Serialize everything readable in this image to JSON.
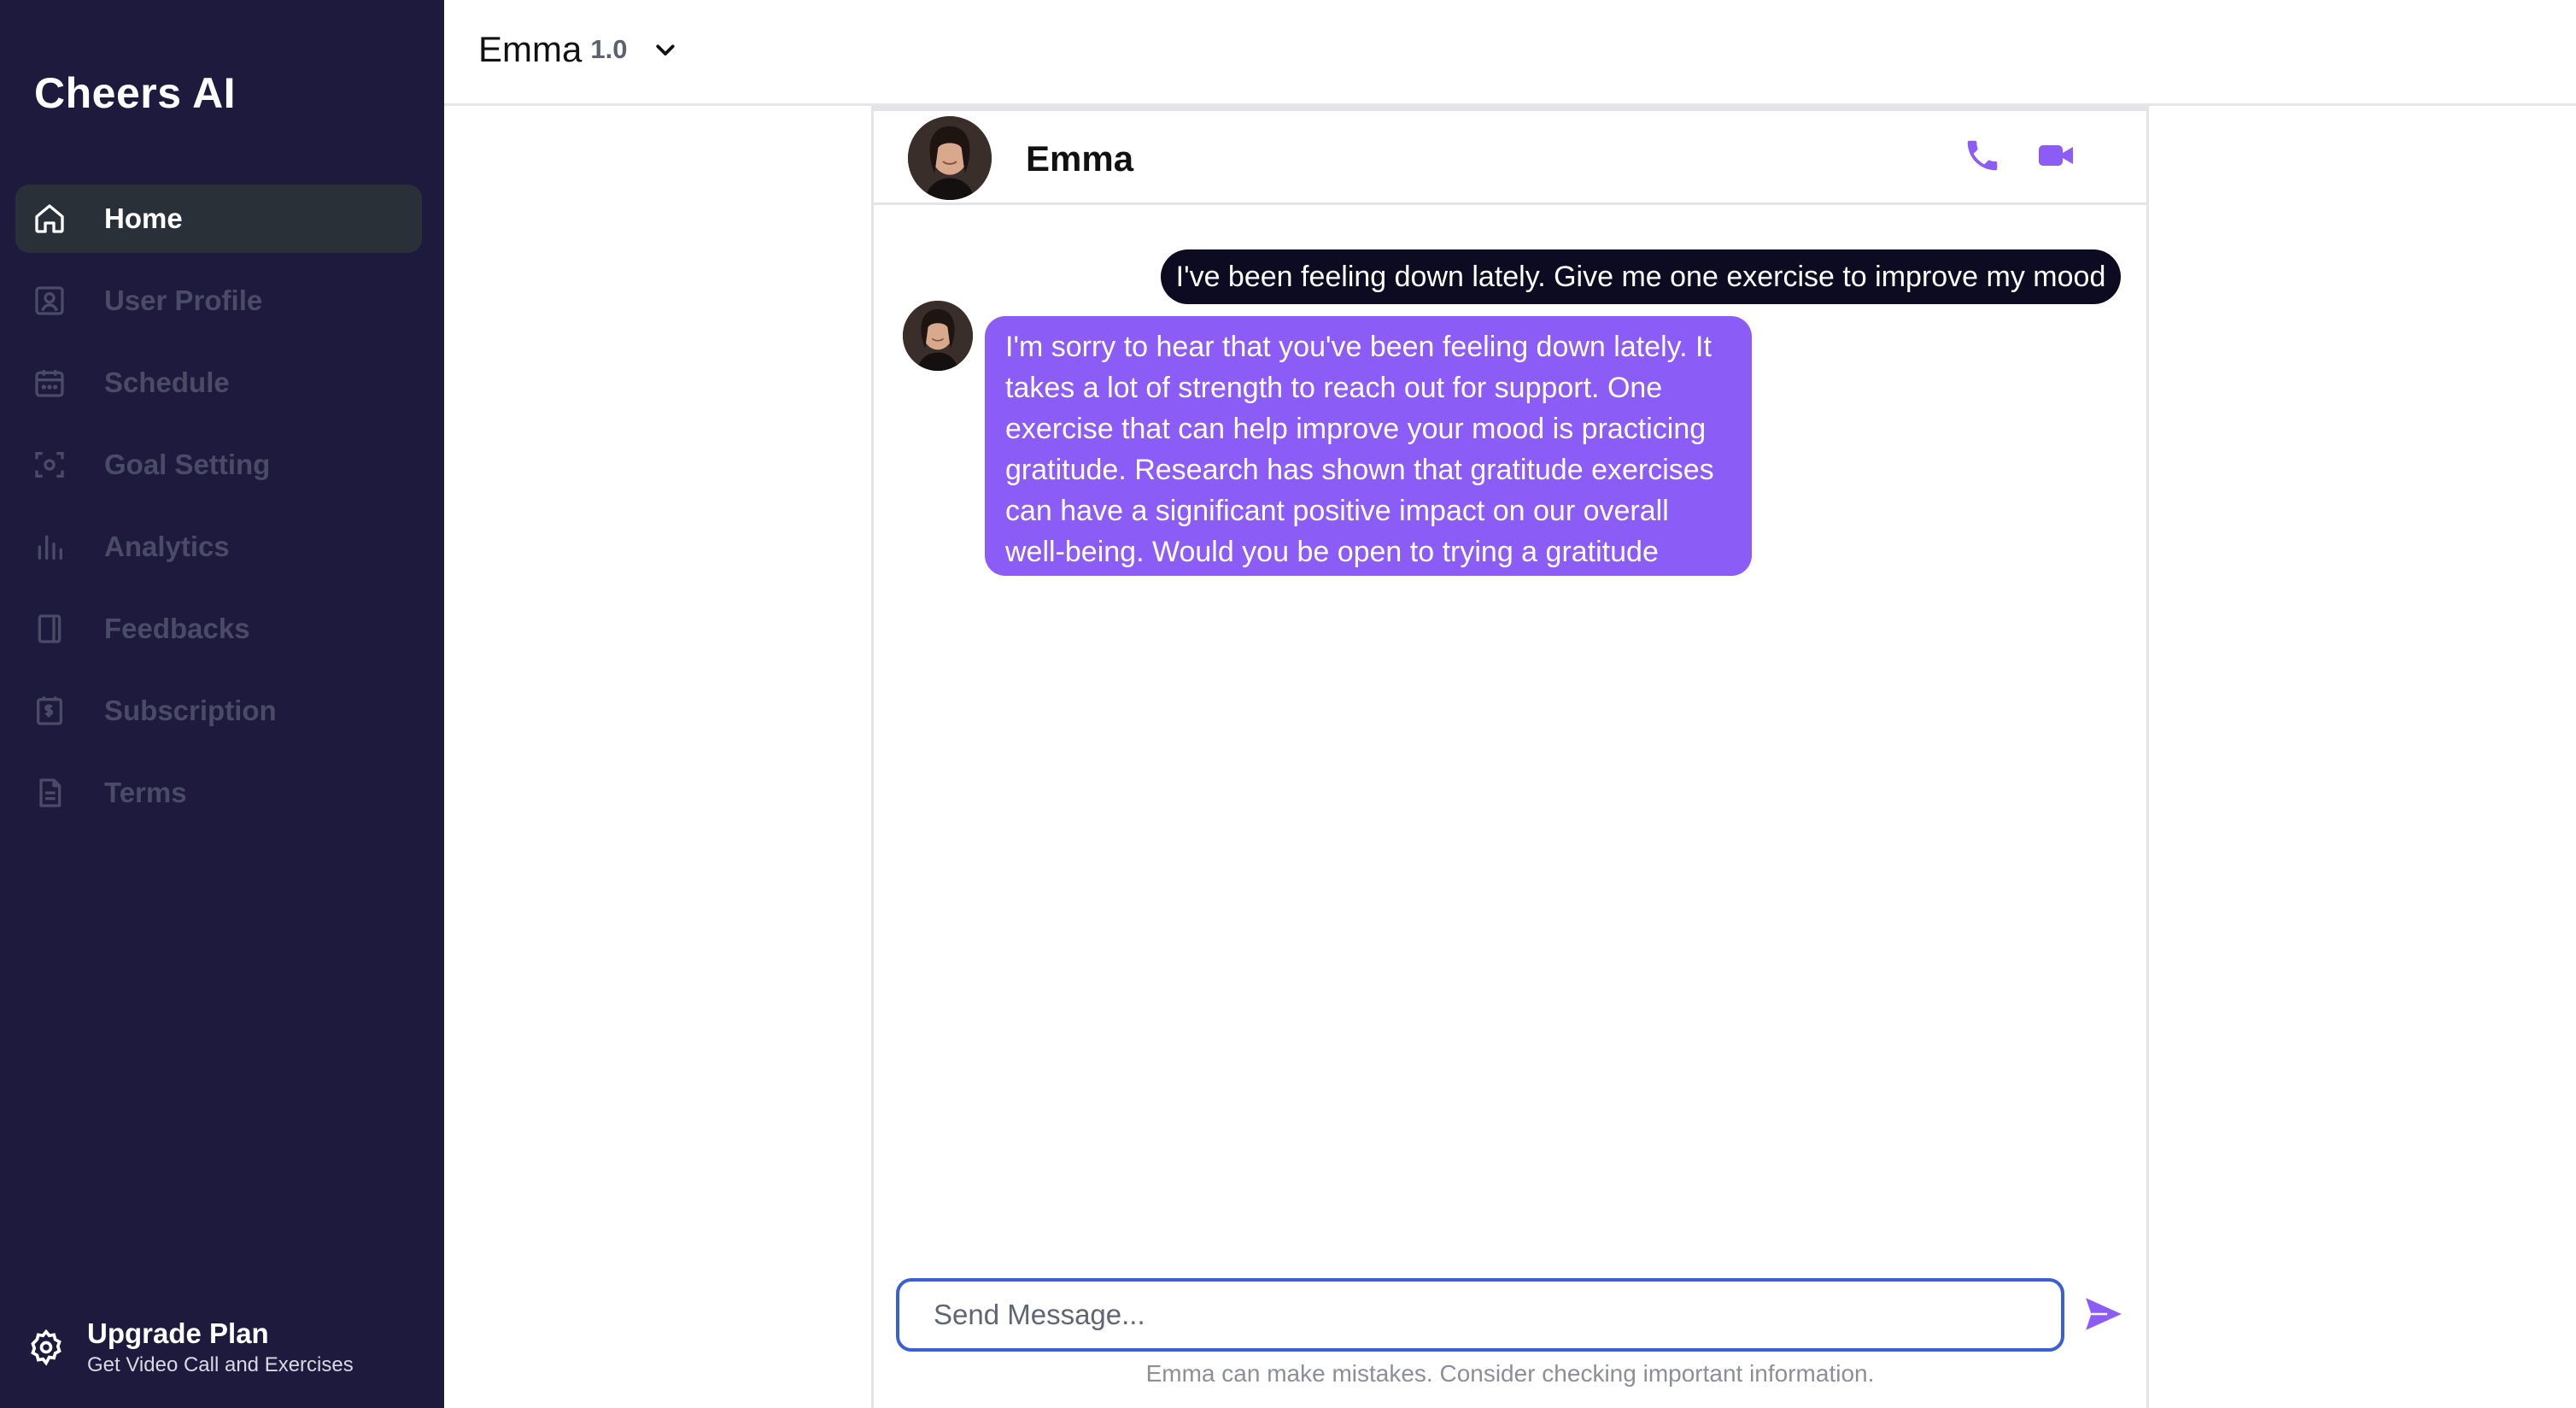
{
  "app": {
    "brand": "Cheers AI"
  },
  "sidebar": {
    "items": [
      {
        "label": "Home",
        "icon": "home-icon",
        "active": true
      },
      {
        "label": "User Profile",
        "icon": "user-profile-icon",
        "active": false
      },
      {
        "label": "Schedule",
        "icon": "calendar-icon",
        "active": false
      },
      {
        "label": "Goal Setting",
        "icon": "target-icon",
        "active": false
      },
      {
        "label": "Analytics",
        "icon": "bar-chart-icon",
        "active": false
      },
      {
        "label": "Feedbacks",
        "icon": "book-icon",
        "active": false
      },
      {
        "label": "Subscription",
        "icon": "billing-icon",
        "active": false
      },
      {
        "label": "Terms",
        "icon": "document-icon",
        "active": false
      }
    ],
    "upgrade": {
      "title": "Upgrade Plan",
      "subtitle": "Get Video Call and Exercises",
      "icon": "gear-icon"
    }
  },
  "topbar": {
    "model_name": "Emma",
    "model_version": "1.0",
    "dropdown_icon": "chevron-down-icon"
  },
  "chat": {
    "header": {
      "name": "Emma",
      "call_icon": "phone-icon",
      "video_icon": "video-camera-icon"
    },
    "messages": [
      {
        "role": "user",
        "text": "I've been feeling down lately. Give me one exercise to improve my mood"
      },
      {
        "role": "assistant",
        "text": "I'm sorry to hear that you've been feeling down lately. It takes a lot of strength to reach out for support. One exercise that can help improve your mood is practicing gratitude. Research has shown that gratitude exercises can have a significant positive impact on our overall well-being. Would you be open to trying a gratitude exercise?"
      }
    ],
    "composer": {
      "placeholder": "Send Message...",
      "value": "",
      "send_icon": "send-icon"
    },
    "disclaimer": "Emma can make mistakes. Consider checking important information."
  },
  "colors": {
    "sidebar_bg": "#1d1a3d",
    "accent": "#8b5cf6",
    "user_bubble": "#0d0b22",
    "input_border": "#3b5fd6"
  }
}
